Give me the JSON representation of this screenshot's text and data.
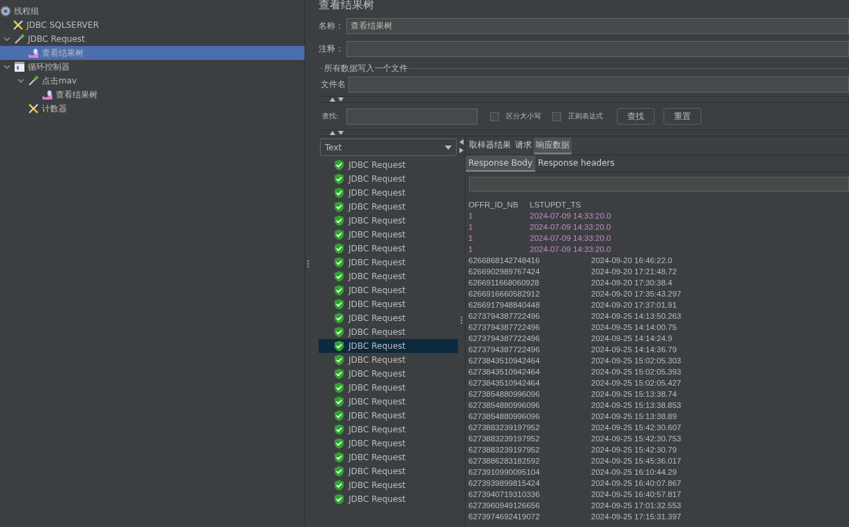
{
  "tree": {
    "label": "线程组",
    "kind": "thread-group",
    "selected": false,
    "children": [
      {
        "label": "JDBC SQLSERVER",
        "kind": "config",
        "selected": false
      },
      {
        "label": "JDBC Request",
        "kind": "sampler",
        "selected": false,
        "expanded": true,
        "children": [
          {
            "label": "查看结果树",
            "kind": "listener",
            "selected": true
          }
        ]
      },
      {
        "label": "循环控制器",
        "kind": "controller",
        "selected": false,
        "expanded": true,
        "children": [
          {
            "label": "点击mav",
            "kind": "sampler",
            "selected": false,
            "expanded": true,
            "children": [
              {
                "label": "查看结果树",
                "kind": "listener",
                "selected": false
              }
            ]
          },
          {
            "label": "计数器",
            "kind": "config",
            "selected": false
          }
        ]
      }
    ]
  },
  "panel_title": "查看结果树",
  "name_field": {
    "label": "名称：",
    "value": "查看结果树"
  },
  "comment_field": {
    "label": "注释："
  },
  "file_section": {
    "legend": "所有数据写入一个文件",
    "label": "文件名"
  },
  "search": {
    "label": "查找:",
    "options": [
      {
        "label": "区分大小写",
        "checked": false
      },
      {
        "label": "正则表达式",
        "checked": false
      }
    ],
    "buttons": [
      "查找",
      "重置"
    ]
  },
  "renderer": "Text",
  "samples": [
    {
      "label": "JDBC Request",
      "selected": false
    },
    {
      "label": "JDBC Request",
      "selected": false
    },
    {
      "label": "JDBC Request",
      "selected": false
    },
    {
      "label": "JDBC Request",
      "selected": false
    },
    {
      "label": "JDBC Request",
      "selected": false
    },
    {
      "label": "JDBC Request",
      "selected": false
    },
    {
      "label": "JDBC Request",
      "selected": false
    },
    {
      "label": "JDBC Request",
      "selected": false
    },
    {
      "label": "JDBC Request",
      "selected": false
    },
    {
      "label": "JDBC Request",
      "selected": false
    },
    {
      "label": "JDBC Request",
      "selected": false
    },
    {
      "label": "JDBC Request",
      "selected": false
    },
    {
      "label": "JDBC Request",
      "selected": false
    },
    {
      "label": "JDBC Request",
      "selected": true
    },
    {
      "label": "JDBC Request",
      "selected": false
    },
    {
      "label": "JDBC Request",
      "selected": false
    },
    {
      "label": "JDBC Request",
      "selected": false
    },
    {
      "label": "JDBC Request",
      "selected": false
    },
    {
      "label": "JDBC Request",
      "selected": false
    },
    {
      "label": "JDBC Request",
      "selected": false
    },
    {
      "label": "JDBC Request",
      "selected": false
    },
    {
      "label": "JDBC Request",
      "selected": false
    },
    {
      "label": "JDBC Request",
      "selected": false
    },
    {
      "label": "JDBC Request",
      "selected": false
    },
    {
      "label": "JDBC Request",
      "selected": false
    }
  ],
  "tabs": [
    {
      "label": "取样器结果",
      "selected": false
    },
    {
      "label": "请求",
      "selected": false
    },
    {
      "label": "响应数据",
      "selected": true
    }
  ],
  "subtabs": [
    {
      "label": "Response Body",
      "selected": true
    },
    {
      "label": "Response headers",
      "selected": false
    }
  ],
  "response_rows": [
    {
      "cells": [
        "OFFR_ID_NB",
        "LSTUPDT_TS"
      ],
      "highlighted": false
    },
    {
      "cells": [
        "1",
        "2024-07-09 14:33:20.0"
      ],
      "highlighted": true
    },
    {
      "cells": [
        "1",
        "2024-07-09 14:33:20.0"
      ],
      "highlighted": true
    },
    {
      "cells": [
        "1",
        "2024-07-09 14:33:20.0"
      ],
      "highlighted": true
    },
    {
      "cells": [
        "1",
        "2024-07-09 14:33:20.0"
      ],
      "highlighted": true
    },
    {
      "cells": [
        "6266868142748416",
        "2024-09-20 16:46:22.0"
      ],
      "highlighted": false
    },
    {
      "cells": [
        "6266902989767424",
        "2024-09-20 17:21:48.72"
      ],
      "highlighted": false
    },
    {
      "cells": [
        "6266911668060928",
        "2024-09-20 17:30:38.4"
      ],
      "highlighted": false
    },
    {
      "cells": [
        "6266916660582912",
        "2024-09-20 17:35:43.297"
      ],
      "highlighted": false
    },
    {
      "cells": [
        "6266917948840448",
        "2024-09-20 17:37:01.91"
      ],
      "highlighted": false
    },
    {
      "cells": [
        "6273794387722496",
        "2024-09-25 14:13:50.263"
      ],
      "highlighted": false
    },
    {
      "cells": [
        "6273794387722496",
        "2024-09-25 14:14:00.75"
      ],
      "highlighted": false
    },
    {
      "cells": [
        "6273794387722496",
        "2024-09-25 14:14:24.9"
      ],
      "highlighted": false
    },
    {
      "cells": [
        "6273794387722496",
        "2024-09-25 14:14:36.79"
      ],
      "highlighted": false
    },
    {
      "cells": [
        "6273843510942464",
        "2024-09-25 15:02:05.303"
      ],
      "highlighted": false
    },
    {
      "cells": [
        "6273843510942464",
        "2024-09-25 15:02:05.393"
      ],
      "highlighted": false
    },
    {
      "cells": [
        "6273843510942464",
        "2024-09-25 15:02:05.427"
      ],
      "highlighted": false
    },
    {
      "cells": [
        "6273854880996096",
        "2024-09-25 15:13:38.74"
      ],
      "highlighted": false
    },
    {
      "cells": [
        "6273854880996096",
        "2024-09-25 15:13:38.853"
      ],
      "highlighted": false
    },
    {
      "cells": [
        "6273854880996096",
        "2024-09-25 15:13:38.89"
      ],
      "highlighted": false
    },
    {
      "cells": [
        "6273883239197952",
        "2024-09-25 15:42:30.607"
      ],
      "highlighted": false
    },
    {
      "cells": [
        "6273883239197952",
        "2024-09-25 15:42:30.753"
      ],
      "highlighted": false
    },
    {
      "cells": [
        "6273883239197952",
        "2024-09-25 15:42:30.79"
      ],
      "highlighted": false
    },
    {
      "cells": [
        "6273886283182592",
        "2024-09-25 15:45:36.017"
      ],
      "highlighted": false
    },
    {
      "cells": [
        "6273910990095104",
        "2024-09-25 16:10:44.29"
      ],
      "highlighted": false
    },
    {
      "cells": [
        "6273939899815424",
        "2024-09-25 16:40:07.867"
      ],
      "highlighted": false
    },
    {
      "cells": [
        "6273940719310336",
        "2024-09-25 16:40:57.817"
      ],
      "highlighted": false
    },
    {
      "cells": [
        "6273960949126656",
        "2024-09-25 17:01:32.553"
      ],
      "highlighted": false
    },
    {
      "cells": [
        "6273974692419072",
        "2024-09-25 17:15:31.397"
      ],
      "highlighted": false
    }
  ]
}
